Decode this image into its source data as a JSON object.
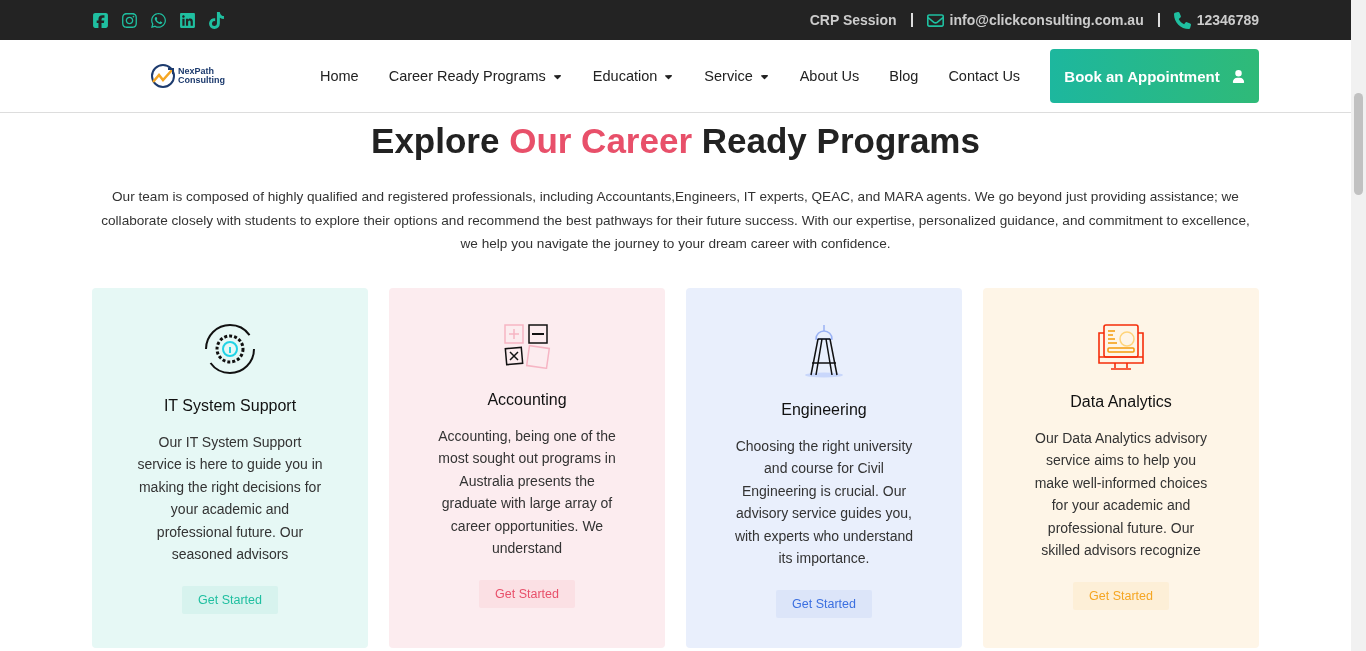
{
  "top_bar": {
    "socials": [
      {
        "kind": "facebook"
      },
      {
        "kind": "instagram"
      },
      {
        "kind": "whatsapp"
      },
      {
        "kind": "linkedin"
      },
      {
        "kind": "tiktok"
      }
    ],
    "session_link": "CRP Session",
    "email": "info@clickconsulting.com.au",
    "phone": "12346789"
  },
  "header": {
    "logo": {
      "name": "NexPath",
      "subtitle": "Consulting"
    },
    "nav": [
      {
        "label": "Home",
        "dropdown": false
      },
      {
        "label": "Career Ready Programs",
        "dropdown": true
      },
      {
        "label": "Education",
        "dropdown": true
      },
      {
        "label": "Service",
        "dropdown": true
      },
      {
        "label": "About Us",
        "dropdown": false
      },
      {
        "label": "Blog",
        "dropdown": false
      },
      {
        "label": "Contact Us",
        "dropdown": false
      }
    ],
    "cta": "Book an Appointment"
  },
  "section": {
    "title": "Explore **Our Career** Ready Programs",
    "intro": "Our team is composed of highly qualified and registered professionals, including Accountants,Engineers, IT experts, QEAC, and MARA agents. We go beyond just providing assistance; we collaborate closely with students to explore their options and recommend the best pathways for their future success. With our expertise, personalized guidance, and commitment to excellence, we help you navigate the journey to your dream career with confidence.",
    "cards": [
      {
        "kind": "gear",
        "title": "IT System Support",
        "text": "Our IT System Support service is here to guide you in making the right decisions for your academic and professional future. Our seasoned advisors",
        "button": "Get Started",
        "color": "#1fbfa0"
      },
      {
        "kind": "calculator",
        "title": "Accounting",
        "text": "Accounting, being one of the most sought out programs in Australia presents the graduate with large array of career opportunities. We understand",
        "button": "Get Started",
        "color": "#e8506a"
      },
      {
        "kind": "compass",
        "title": "Engineering",
        "text": "Choosing the right university and course for Civil Engineering is crucial. Our advisory service guides you, with experts who understand its importance.",
        "button": "Get Started",
        "color": "#3b6fe0"
      },
      {
        "kind": "monitor",
        "title": "Data Analytics",
        "text": "Our Data Analytics advisory service aims to help you make well-informed choices for your academic and professional future. Our skilled advisors recognize",
        "button": "Get Started",
        "color": "#f5a623"
      }
    ]
  }
}
